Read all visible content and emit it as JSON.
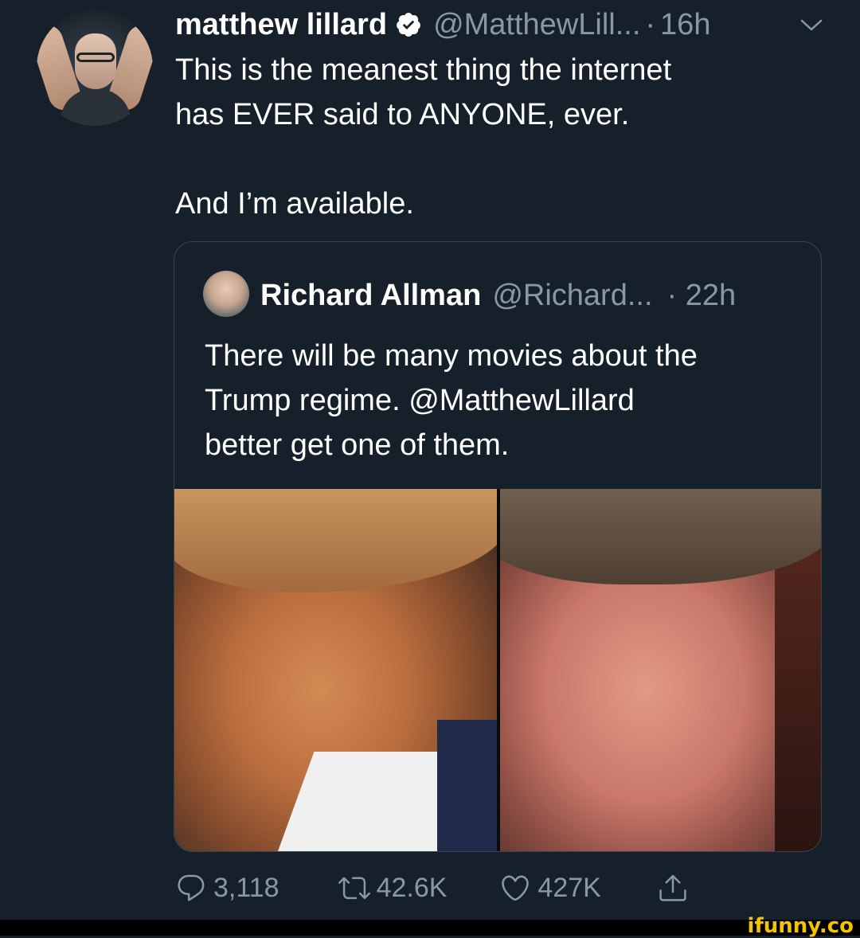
{
  "tweet": {
    "display_name": "matthew lillard",
    "handle": "@MatthewLill...",
    "separator": "·",
    "time": "16h",
    "text_lines": [
      "This is the meanest thing the internet",
      "has EVER said to ANYONE, ever.",
      "And I’m available."
    ]
  },
  "quote": {
    "display_name": "Richard Allman",
    "handle": "@Richard...",
    "time": "· 22h",
    "text_lines": [
      "There will be many movies about the",
      "Trump regime. @MatthewLillard",
      "better get one of them."
    ]
  },
  "actions": {
    "replies": "3,118",
    "retweets": "42.6K",
    "likes": "427K"
  },
  "watermark": "ifunny.co",
  "icons": {
    "verified": "verified-badge-icon",
    "chevron": "chevron-down-icon",
    "reply": "reply-icon",
    "retweet": "retweet-icon",
    "like": "heart-icon",
    "share": "share-icon"
  },
  "colors": {
    "background": "#15202b",
    "secondary_text": "#8899a6",
    "border": "#38444d",
    "watermark": "#f3c400"
  }
}
